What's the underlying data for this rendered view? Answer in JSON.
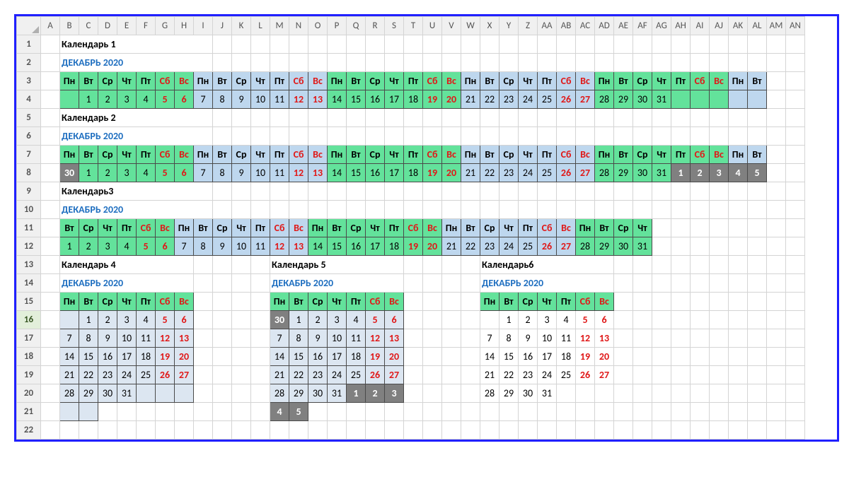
{
  "columns": [
    "A",
    "B",
    "C",
    "D",
    "E",
    "F",
    "G",
    "H",
    "I",
    "J",
    "K",
    "L",
    "M",
    "N",
    "O",
    "P",
    "Q",
    "R",
    "S",
    "T",
    "U",
    "V",
    "W",
    "X",
    "Y",
    "Z",
    "AA",
    "AB",
    "AC",
    "AD",
    "AE",
    "AF",
    "AG",
    "AH",
    "AI",
    "AJ",
    "AK",
    "AL",
    "AM",
    "AN"
  ],
  "rows": [
    "1",
    "2",
    "3",
    "4",
    "5",
    "6",
    "7",
    "8",
    "9",
    "10",
    "11",
    "12",
    "13",
    "14",
    "15",
    "16",
    "17",
    "18",
    "19",
    "20",
    "21",
    "22"
  ],
  "selectedRow": "16",
  "titles": {
    "cal1": "Календарь 1",
    "cal2": "Календарь 2",
    "cal3": "Календарь3",
    "cal4": "Календарь 4",
    "cal5": "Календарь 5",
    "cal6": "Календарь6",
    "month": "ДЕКАБРЬ 2020"
  },
  "dow": [
    "Пн",
    "Вт",
    "Ср",
    "Чт",
    "Пт",
    "Сб",
    "Вс"
  ],
  "cal_long_header": [
    {
      "d": "Пн",
      "g": "green"
    },
    {
      "d": "Вт",
      "g": "green"
    },
    {
      "d": "Ср",
      "g": "green"
    },
    {
      "d": "Чт",
      "g": "green"
    },
    {
      "d": "Пт",
      "g": "green"
    },
    {
      "d": "Сб",
      "g": "green",
      "red": true
    },
    {
      "d": "Вс",
      "g": "green",
      "red": true
    },
    {
      "d": "Пн",
      "g": "blue"
    },
    {
      "d": "Вт",
      "g": "blue"
    },
    {
      "d": "Ср",
      "g": "blue"
    },
    {
      "d": "Чт",
      "g": "blue"
    },
    {
      "d": "Пт",
      "g": "blue"
    },
    {
      "d": "Сб",
      "g": "blue",
      "red": true
    },
    {
      "d": "Вс",
      "g": "blue",
      "red": true
    },
    {
      "d": "Пн",
      "g": "green"
    },
    {
      "d": "Вт",
      "g": "green"
    },
    {
      "d": "Ср",
      "g": "green"
    },
    {
      "d": "Чт",
      "g": "green"
    },
    {
      "d": "Пт",
      "g": "green"
    },
    {
      "d": "Сб",
      "g": "green",
      "red": true
    },
    {
      "d": "Вс",
      "g": "green",
      "red": true
    },
    {
      "d": "Пн",
      "g": "blue"
    },
    {
      "d": "Вт",
      "g": "blue"
    },
    {
      "d": "Ср",
      "g": "blue"
    },
    {
      "d": "Чт",
      "g": "blue"
    },
    {
      "d": "Пт",
      "g": "blue"
    },
    {
      "d": "Сб",
      "g": "blue",
      "red": true
    },
    {
      "d": "Вс",
      "g": "blue",
      "red": true
    },
    {
      "d": "Пн",
      "g": "green"
    },
    {
      "d": "Вт",
      "g": "green"
    },
    {
      "d": "Ср",
      "g": "green"
    },
    {
      "d": "Чт",
      "g": "green"
    },
    {
      "d": "Пт",
      "g": "green"
    },
    {
      "d": "Сб",
      "g": "green",
      "red": true
    },
    {
      "d": "Вс",
      "g": "green",
      "red": true
    },
    {
      "d": "Пн",
      "g": "blue"
    },
    {
      "d": "Вт",
      "g": "blue"
    }
  ],
  "cal1_row": [
    {
      "v": "",
      "g": "green"
    },
    {
      "v": "1",
      "g": "green"
    },
    {
      "v": "2",
      "g": "green"
    },
    {
      "v": "3",
      "g": "green"
    },
    {
      "v": "4",
      "g": "green"
    },
    {
      "v": "5",
      "g": "green",
      "red": true
    },
    {
      "v": "6",
      "g": "green",
      "red": true
    },
    {
      "v": "7",
      "g": "blue"
    },
    {
      "v": "8",
      "g": "blue"
    },
    {
      "v": "9",
      "g": "blue"
    },
    {
      "v": "10",
      "g": "blue"
    },
    {
      "v": "11",
      "g": "blue"
    },
    {
      "v": "12",
      "g": "blue",
      "red": true
    },
    {
      "v": "13",
      "g": "blue",
      "red": true
    },
    {
      "v": "14",
      "g": "green"
    },
    {
      "v": "15",
      "g": "green"
    },
    {
      "v": "16",
      "g": "green"
    },
    {
      "v": "17",
      "g": "green"
    },
    {
      "v": "18",
      "g": "green"
    },
    {
      "v": "19",
      "g": "green",
      "red": true
    },
    {
      "v": "20",
      "g": "green",
      "red": true
    },
    {
      "v": "21",
      "g": "blue"
    },
    {
      "v": "22",
      "g": "blue"
    },
    {
      "v": "23",
      "g": "blue"
    },
    {
      "v": "24",
      "g": "blue"
    },
    {
      "v": "25",
      "g": "blue"
    },
    {
      "v": "26",
      "g": "blue",
      "red": true
    },
    {
      "v": "27",
      "g": "blue",
      "red": true
    },
    {
      "v": "28",
      "g": "green"
    },
    {
      "v": "29",
      "g": "green"
    },
    {
      "v": "30",
      "g": "green"
    },
    {
      "v": "31",
      "g": "green"
    },
    {
      "v": "",
      "g": "green"
    },
    {
      "v": "",
      "g": "green"
    },
    {
      "v": "",
      "g": "green"
    },
    {
      "v": "",
      "g": "blue"
    },
    {
      "v": "",
      "g": "blue"
    }
  ],
  "cal2_row": [
    {
      "v": "30",
      "g": "grey"
    },
    {
      "v": "1",
      "g": "green"
    },
    {
      "v": "2",
      "g": "green"
    },
    {
      "v": "3",
      "g": "green"
    },
    {
      "v": "4",
      "g": "green"
    },
    {
      "v": "5",
      "g": "green",
      "red": true
    },
    {
      "v": "6",
      "g": "green",
      "red": true
    },
    {
      "v": "7",
      "g": "blue"
    },
    {
      "v": "8",
      "g": "blue"
    },
    {
      "v": "9",
      "g": "blue"
    },
    {
      "v": "10",
      "g": "blue"
    },
    {
      "v": "11",
      "g": "blue"
    },
    {
      "v": "12",
      "g": "blue",
      "red": true
    },
    {
      "v": "13",
      "g": "blue",
      "red": true
    },
    {
      "v": "14",
      "g": "green"
    },
    {
      "v": "15",
      "g": "green"
    },
    {
      "v": "16",
      "g": "green"
    },
    {
      "v": "17",
      "g": "green"
    },
    {
      "v": "18",
      "g": "green"
    },
    {
      "v": "19",
      "g": "green",
      "red": true
    },
    {
      "v": "20",
      "g": "green",
      "red": true
    },
    {
      "v": "21",
      "g": "blue"
    },
    {
      "v": "22",
      "g": "blue"
    },
    {
      "v": "23",
      "g": "blue"
    },
    {
      "v": "24",
      "g": "blue"
    },
    {
      "v": "25",
      "g": "blue"
    },
    {
      "v": "26",
      "g": "blue",
      "red": true
    },
    {
      "v": "27",
      "g": "blue",
      "red": true
    },
    {
      "v": "28",
      "g": "green"
    },
    {
      "v": "29",
      "g": "green"
    },
    {
      "v": "30",
      "g": "green"
    },
    {
      "v": "31",
      "g": "green"
    },
    {
      "v": "1",
      "g": "grey"
    },
    {
      "v": "2",
      "g": "grey"
    },
    {
      "v": "3",
      "g": "grey"
    },
    {
      "v": "4",
      "g": "grey"
    },
    {
      "v": "5",
      "g": "grey"
    }
  ],
  "cal3_header": [
    {
      "d": "Вт",
      "g": "green"
    },
    {
      "d": "Ср",
      "g": "green"
    },
    {
      "d": "Чт",
      "g": "green"
    },
    {
      "d": "Пт",
      "g": "green"
    },
    {
      "d": "Сб",
      "g": "green",
      "red": true
    },
    {
      "d": "Вс",
      "g": "green",
      "red": true
    },
    {
      "d": "Пн",
      "g": "blue"
    },
    {
      "d": "Вт",
      "g": "blue"
    },
    {
      "d": "Ср",
      "g": "blue"
    },
    {
      "d": "Чт",
      "g": "blue"
    },
    {
      "d": "Пт",
      "g": "blue"
    },
    {
      "d": "Сб",
      "g": "blue",
      "red": true
    },
    {
      "d": "Вс",
      "g": "blue",
      "red": true
    },
    {
      "d": "Пн",
      "g": "green"
    },
    {
      "d": "Вт",
      "g": "green"
    },
    {
      "d": "Ср",
      "g": "green"
    },
    {
      "d": "Чт",
      "g": "green"
    },
    {
      "d": "Пт",
      "g": "green"
    },
    {
      "d": "Сб",
      "g": "green",
      "red": true
    },
    {
      "d": "Вс",
      "g": "green",
      "red": true
    },
    {
      "d": "Пн",
      "g": "blue"
    },
    {
      "d": "Вт",
      "g": "blue"
    },
    {
      "d": "Ср",
      "g": "blue"
    },
    {
      "d": "Чт",
      "g": "blue"
    },
    {
      "d": "Пт",
      "g": "blue"
    },
    {
      "d": "Сб",
      "g": "blue",
      "red": true
    },
    {
      "d": "Вс",
      "g": "blue",
      "red": true
    },
    {
      "d": "Пн",
      "g": "green"
    },
    {
      "d": "Вт",
      "g": "green"
    },
    {
      "d": "Ср",
      "g": "green"
    },
    {
      "d": "Чт",
      "g": "green"
    }
  ],
  "cal3_row": [
    {
      "v": "1",
      "g": "green"
    },
    {
      "v": "2",
      "g": "green"
    },
    {
      "v": "3",
      "g": "green"
    },
    {
      "v": "4",
      "g": "green"
    },
    {
      "v": "5",
      "g": "green",
      "red": true
    },
    {
      "v": "6",
      "g": "green",
      "red": true
    },
    {
      "v": "7",
      "g": "blue"
    },
    {
      "v": "8",
      "g": "blue"
    },
    {
      "v": "9",
      "g": "blue"
    },
    {
      "v": "10",
      "g": "blue"
    },
    {
      "v": "11",
      "g": "blue"
    },
    {
      "v": "12",
      "g": "blue",
      "red": true
    },
    {
      "v": "13",
      "g": "blue",
      "red": true
    },
    {
      "v": "14",
      "g": "green"
    },
    {
      "v": "15",
      "g": "green"
    },
    {
      "v": "16",
      "g": "green"
    },
    {
      "v": "17",
      "g": "green"
    },
    {
      "v": "18",
      "g": "green"
    },
    {
      "v": "19",
      "g": "green",
      "red": true
    },
    {
      "v": "20",
      "g": "green",
      "red": true
    },
    {
      "v": "21",
      "g": "blue"
    },
    {
      "v": "22",
      "g": "blue"
    },
    {
      "v": "23",
      "g": "blue"
    },
    {
      "v": "24",
      "g": "blue"
    },
    {
      "v": "25",
      "g": "blue"
    },
    {
      "v": "26",
      "g": "blue",
      "red": true
    },
    {
      "v": "27",
      "g": "blue",
      "red": true
    },
    {
      "v": "28",
      "g": "green"
    },
    {
      "v": "29",
      "g": "green"
    },
    {
      "v": "30",
      "g": "green"
    },
    {
      "v": "31",
      "g": "green"
    }
  ],
  "cal4": {
    "dow": [
      {
        "d": "Пн"
      },
      {
        "d": "Вт"
      },
      {
        "d": "Ср"
      },
      {
        "d": "Чт"
      },
      {
        "d": "Пт"
      },
      {
        "d": "Сб",
        "red": true
      },
      {
        "d": "Вс",
        "red": true
      }
    ],
    "rows": [
      [
        {
          "v": ""
        },
        {
          "v": "1"
        },
        {
          "v": "2"
        },
        {
          "v": "3"
        },
        {
          "v": "4"
        },
        {
          "v": "5",
          "red": true
        },
        {
          "v": "6",
          "red": true
        }
      ],
      [
        {
          "v": "7"
        },
        {
          "v": "8"
        },
        {
          "v": "9"
        },
        {
          "v": "10"
        },
        {
          "v": "11"
        },
        {
          "v": "12",
          "red": true
        },
        {
          "v": "13",
          "red": true
        }
      ],
      [
        {
          "v": "14"
        },
        {
          "v": "15"
        },
        {
          "v": "16"
        },
        {
          "v": "17"
        },
        {
          "v": "18"
        },
        {
          "v": "19",
          "red": true
        },
        {
          "v": "20",
          "red": true
        }
      ],
      [
        {
          "v": "21"
        },
        {
          "v": "22"
        },
        {
          "v": "23"
        },
        {
          "v": "24"
        },
        {
          "v": "25"
        },
        {
          "v": "26",
          "red": true
        },
        {
          "v": "27",
          "red": true
        }
      ],
      [
        {
          "v": "28"
        },
        {
          "v": "29"
        },
        {
          "v": "30"
        },
        {
          "v": "31"
        },
        {
          "v": ""
        },
        {
          "v": ""
        },
        {
          "v": ""
        }
      ],
      [
        {
          "v": ""
        },
        {
          "v": ""
        },
        {
          "v": "",
          "nb": true
        },
        {
          "v": "",
          "nb": true
        },
        {
          "v": "",
          "nb": true
        },
        {
          "v": "",
          "nb": true
        },
        {
          "v": "",
          "nb": true
        }
      ]
    ]
  },
  "cal5": {
    "dow": [
      {
        "d": "Пн"
      },
      {
        "d": "Вт"
      },
      {
        "d": "Ср"
      },
      {
        "d": "Чт"
      },
      {
        "d": "Пт"
      },
      {
        "d": "Сб",
        "red": true
      },
      {
        "d": "Вс",
        "red": true
      }
    ],
    "rows": [
      [
        {
          "v": "30",
          "grey": true
        },
        {
          "v": "1"
        },
        {
          "v": "2"
        },
        {
          "v": "3"
        },
        {
          "v": "4"
        },
        {
          "v": "5",
          "red": true
        },
        {
          "v": "6",
          "red": true
        }
      ],
      [
        {
          "v": "7"
        },
        {
          "v": "8"
        },
        {
          "v": "9"
        },
        {
          "v": "10"
        },
        {
          "v": "11"
        },
        {
          "v": "12",
          "red": true
        },
        {
          "v": "13",
          "red": true
        }
      ],
      [
        {
          "v": "14"
        },
        {
          "v": "15"
        },
        {
          "v": "16"
        },
        {
          "v": "17"
        },
        {
          "v": "18"
        },
        {
          "v": "19",
          "red": true
        },
        {
          "v": "20",
          "red": true
        }
      ],
      [
        {
          "v": "21"
        },
        {
          "v": "22"
        },
        {
          "v": "23"
        },
        {
          "v": "24"
        },
        {
          "v": "25"
        },
        {
          "v": "26",
          "red": true
        },
        {
          "v": "27",
          "red": true
        }
      ],
      [
        {
          "v": "28"
        },
        {
          "v": "29"
        },
        {
          "v": "30"
        },
        {
          "v": "31"
        },
        {
          "v": "1",
          "grey": true
        },
        {
          "v": "2",
          "grey": true
        },
        {
          "v": "3",
          "grey": true
        }
      ],
      [
        {
          "v": "4",
          "grey": true
        },
        {
          "v": "5",
          "grey": true
        },
        {
          "v": "",
          "nb": true
        },
        {
          "v": "",
          "nb": true
        },
        {
          "v": "",
          "nb": true
        },
        {
          "v": "",
          "nb": true
        },
        {
          "v": "",
          "nb": true
        }
      ]
    ]
  },
  "cal6": {
    "dow": [
      {
        "d": "Пн"
      },
      {
        "d": "Вт"
      },
      {
        "d": "Ср"
      },
      {
        "d": "Чт"
      },
      {
        "d": "Пт"
      },
      {
        "d": "Сб",
        "red": true
      },
      {
        "d": "Вс",
        "red": true
      }
    ],
    "rows": [
      [
        {
          "v": ""
        },
        {
          "v": "1"
        },
        {
          "v": "2"
        },
        {
          "v": "3"
        },
        {
          "v": "4"
        },
        {
          "v": "5",
          "red": true
        },
        {
          "v": "6",
          "red": true
        }
      ],
      [
        {
          "v": "7"
        },
        {
          "v": "8"
        },
        {
          "v": "9"
        },
        {
          "v": "10"
        },
        {
          "v": "11"
        },
        {
          "v": "12",
          "red": true
        },
        {
          "v": "13",
          "red": true
        }
      ],
      [
        {
          "v": "14"
        },
        {
          "v": "15"
        },
        {
          "v": "16"
        },
        {
          "v": "17"
        },
        {
          "v": "18"
        },
        {
          "v": "19",
          "red": true
        },
        {
          "v": "20",
          "red": true
        }
      ],
      [
        {
          "v": "21"
        },
        {
          "v": "22"
        },
        {
          "v": "23"
        },
        {
          "v": "24"
        },
        {
          "v": "25"
        },
        {
          "v": "26",
          "red": true
        },
        {
          "v": "27",
          "red": true
        }
      ],
      [
        {
          "v": "28"
        },
        {
          "v": "29"
        },
        {
          "v": "30"
        },
        {
          "v": "31"
        },
        {
          "v": ""
        },
        {
          "v": ""
        },
        {
          "v": ""
        }
      ]
    ]
  }
}
